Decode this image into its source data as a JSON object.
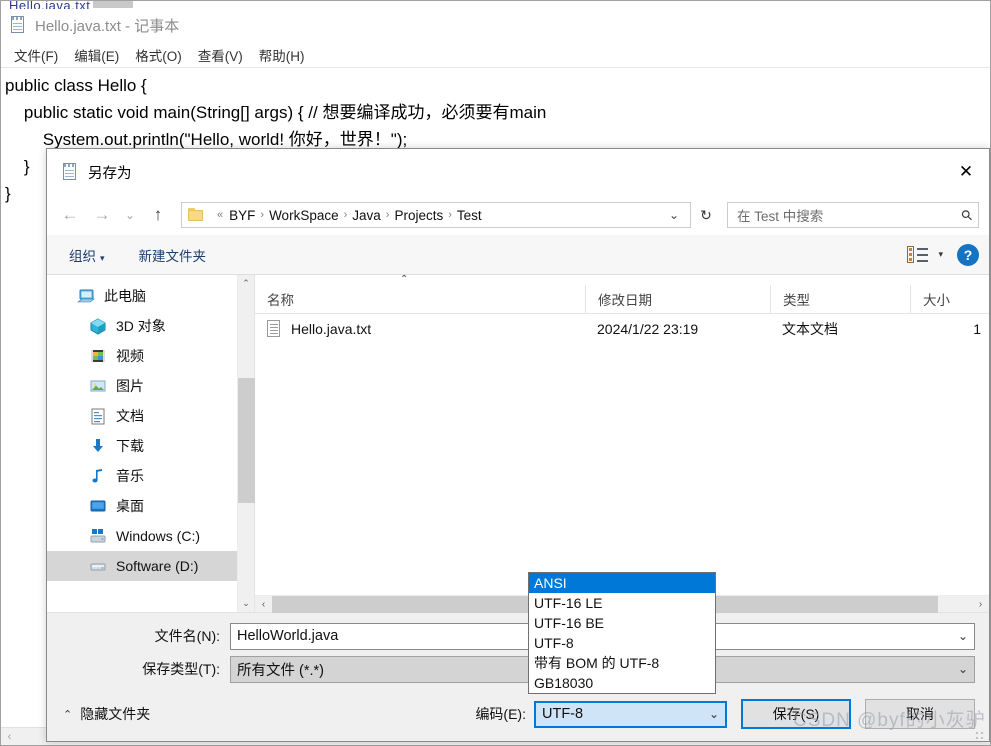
{
  "notepad": {
    "title": "Hello.java.txt - 记事本",
    "icon": "notepad-icon",
    "menus": [
      "文件(F)",
      "编辑(E)",
      "格式(O)",
      "查看(V)",
      "帮助(H)"
    ],
    "code_lines": [
      "public class Hello {",
      "    public static void main(String[] args) { // 想要编译成功，必须要有main",
      "        System.out.println(\"Hello, world! 你好，世界！\");",
      "    }",
      "}"
    ],
    "sliver_text": "Hello.java.txt",
    "hscroll_left": "‹",
    "hscroll_right": "›"
  },
  "dialog": {
    "title": "另存为",
    "icon": "notepad-icon",
    "close_label": "✕",
    "nav": {
      "back": "←",
      "forward": "→",
      "recent": "⌄",
      "up": "↑"
    },
    "breadcrumb": {
      "prefix": "«",
      "items": [
        "BYF",
        "WorkSpace",
        "Java",
        "Projects",
        "Test"
      ],
      "separator": "›",
      "dropdown_caret": "⌄",
      "refresh": "↻"
    },
    "search": {
      "placeholder": "在 Test 中搜索",
      "icon": "search-icon"
    },
    "commandbar": {
      "organize": "组织",
      "organize_caret": "▾",
      "new_folder": "新建文件夹",
      "view_caret": "▾",
      "help": "?"
    },
    "nav_pane": {
      "items": [
        {
          "label": "此电脑",
          "icon": "this-pc-icon",
          "indent": false,
          "selected": false
        },
        {
          "label": "3D 对象",
          "icon": "3d-objects-icon",
          "indent": true,
          "selected": false
        },
        {
          "label": "视频",
          "icon": "videos-icon",
          "indent": true,
          "selected": false
        },
        {
          "label": "图片",
          "icon": "pictures-icon",
          "indent": true,
          "selected": false
        },
        {
          "label": "文档",
          "icon": "documents-icon",
          "indent": true,
          "selected": false
        },
        {
          "label": "下载",
          "icon": "downloads-icon",
          "indent": true,
          "selected": false
        },
        {
          "label": "音乐",
          "icon": "music-icon",
          "indent": true,
          "selected": false
        },
        {
          "label": "桌面",
          "icon": "desktop-icon",
          "indent": true,
          "selected": false
        },
        {
          "label": "Windows (C:)",
          "icon": "drive-windows-icon",
          "indent": true,
          "selected": false
        },
        {
          "label": "Software (D:)",
          "icon": "drive-icon",
          "indent": true,
          "selected": true
        }
      ],
      "scroll_up": "⌃",
      "scroll_down": "⌄"
    },
    "file_list": {
      "sort_indicator": "⌃",
      "columns": [
        "名称",
        "修改日期",
        "类型",
        "大小"
      ],
      "rows": [
        {
          "name": "Hello.java.txt",
          "modified": "2024/1/22 23:19",
          "type": "文本文档",
          "size": "1",
          "icon": "text-file-icon"
        }
      ],
      "hscroll_left": "‹",
      "hscroll_right": "›"
    },
    "form": {
      "filename_label": "文件名(N):",
      "filename_value": "HelloWorld.java",
      "filetype_label": "保存类型(T):",
      "filetype_value": "所有文件  (*.*)",
      "dropdown_caret": "⌄"
    },
    "bottom": {
      "hide_folders": "隐藏文件夹",
      "hide_folders_caret": "⌃",
      "encoding_label": "编码(E):",
      "encoding_value": "UTF-8",
      "encoding_caret": "⌄",
      "save_button": "保存(S)",
      "cancel_button": "取消"
    },
    "encoding_dropdown": {
      "options": [
        "ANSI",
        "UTF-16 LE",
        "UTF-16 BE",
        "UTF-8",
        "带有 BOM 的 UTF-8",
        "GB18030"
      ],
      "selected_index": 0
    }
  },
  "watermark": {
    "text": "CSDN @byf的小灰驴"
  },
  "colors": {
    "accent": "#0078d7",
    "selection": "#0078d7",
    "nav_selected": "#d6d6d6",
    "dialog_bg": "#f0f0f0",
    "link_text": "#1c3f6e"
  }
}
